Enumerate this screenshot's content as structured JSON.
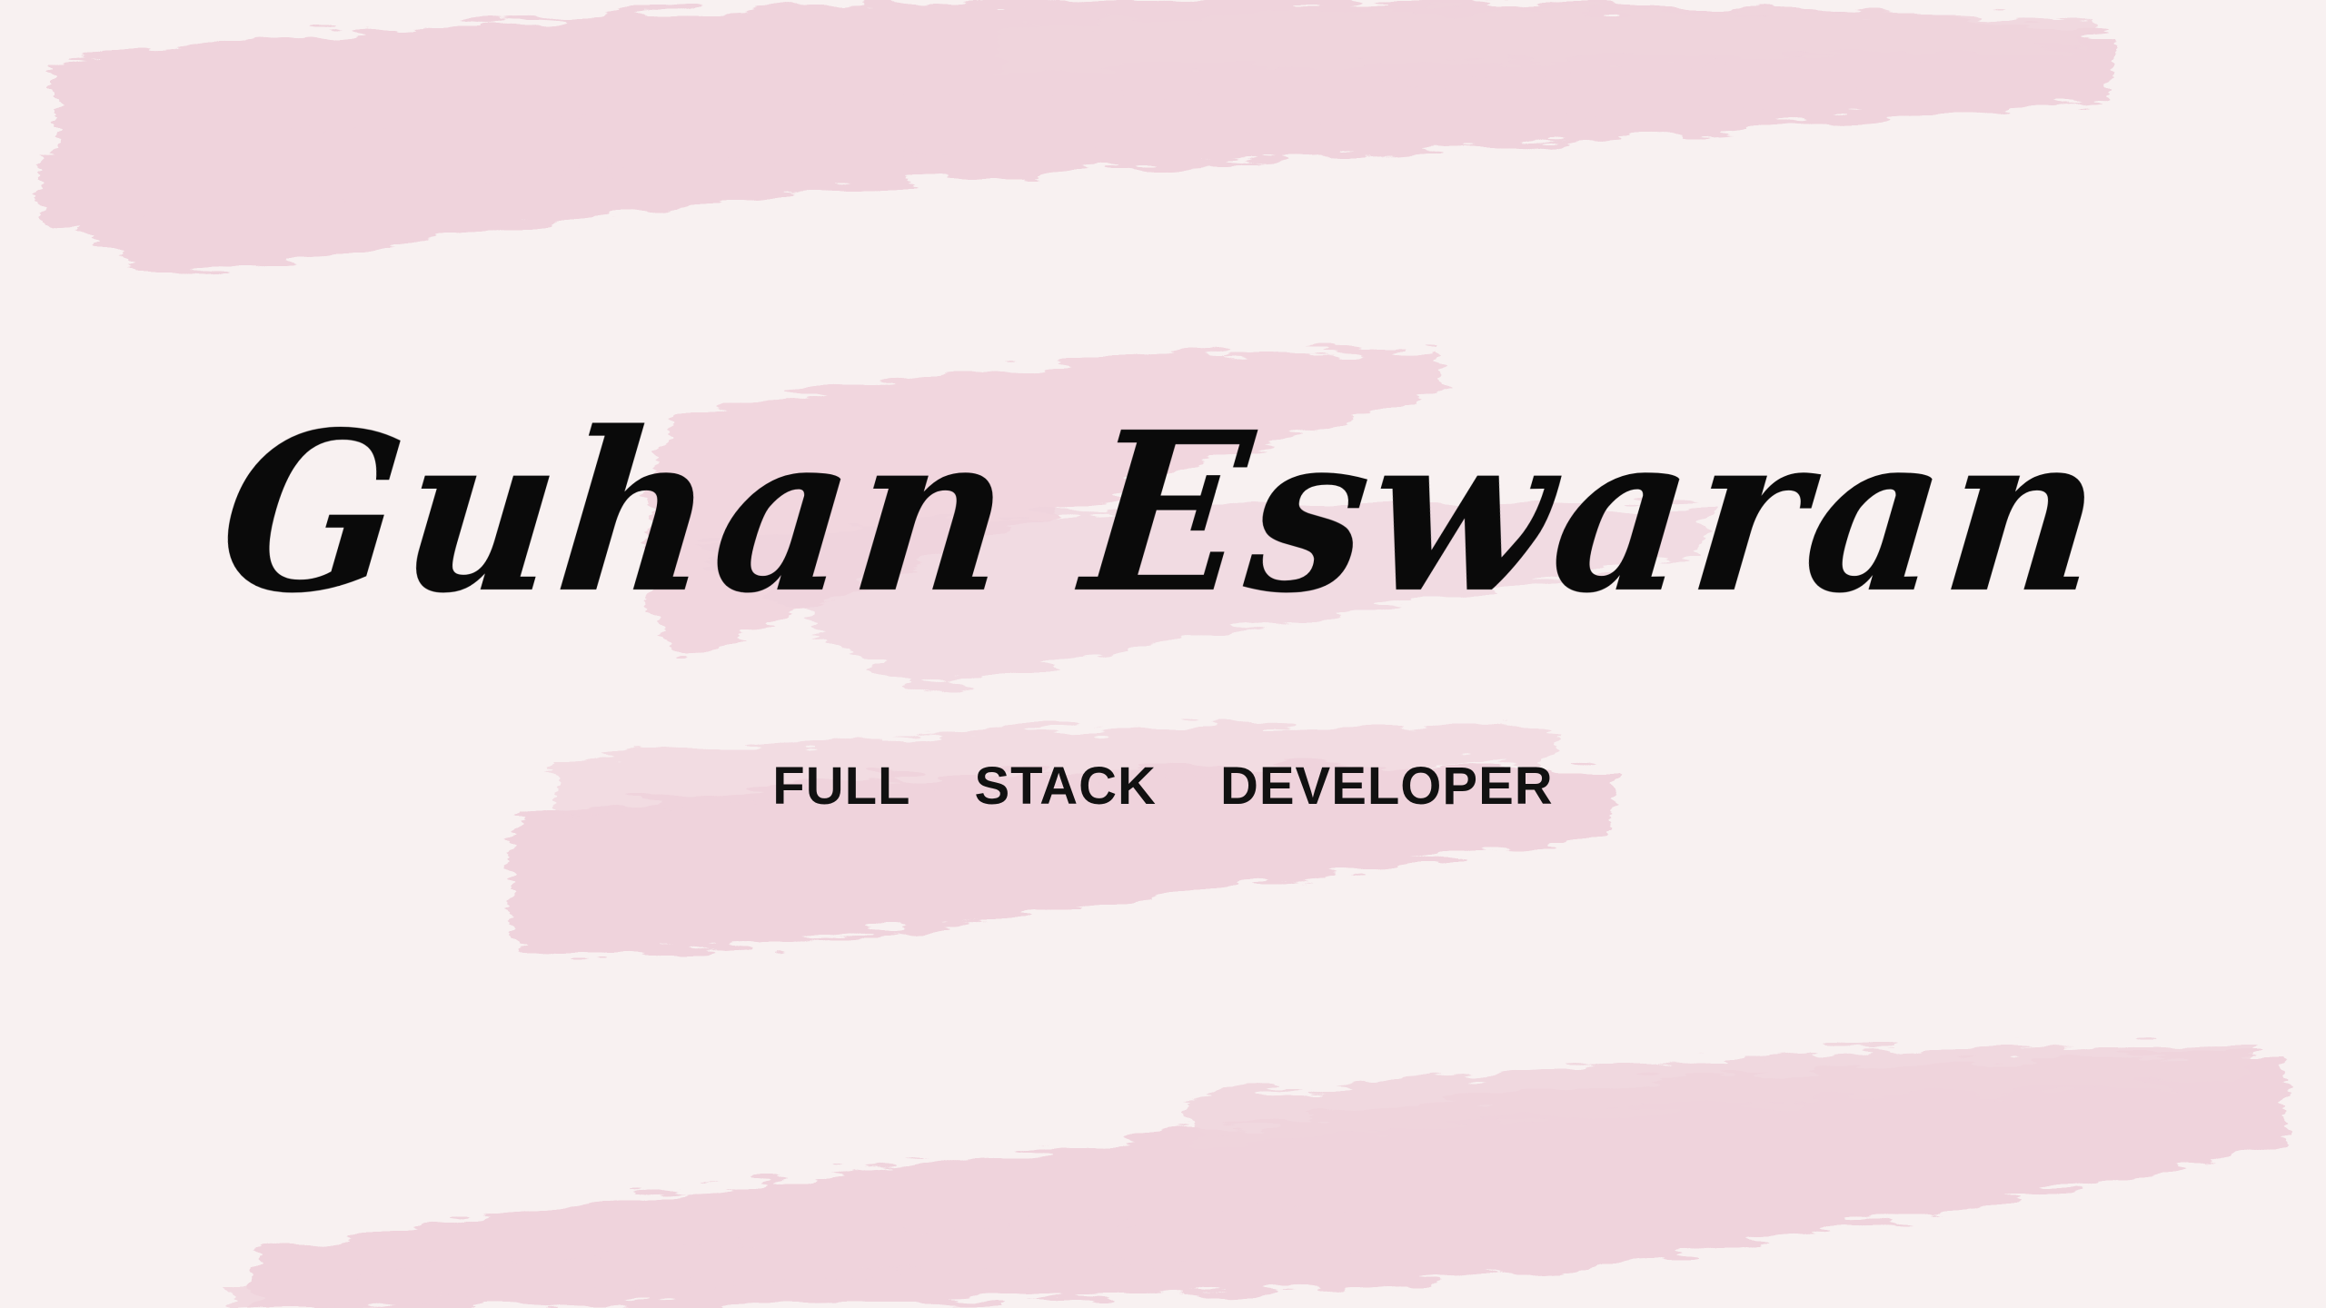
{
  "profile": {
    "name": "Guhan Eswaran",
    "role_words": [
      "FULL",
      "STACK",
      "DEVELOPER"
    ]
  },
  "colors": {
    "background": "#f8f1f1",
    "brush_stroke": "#efd3dc",
    "text": "#0a0a0a"
  },
  "decorations": {
    "brush_strokes": [
      "top-brush-stroke",
      "middle-brush-stroke",
      "bottom-brush-stroke"
    ]
  }
}
